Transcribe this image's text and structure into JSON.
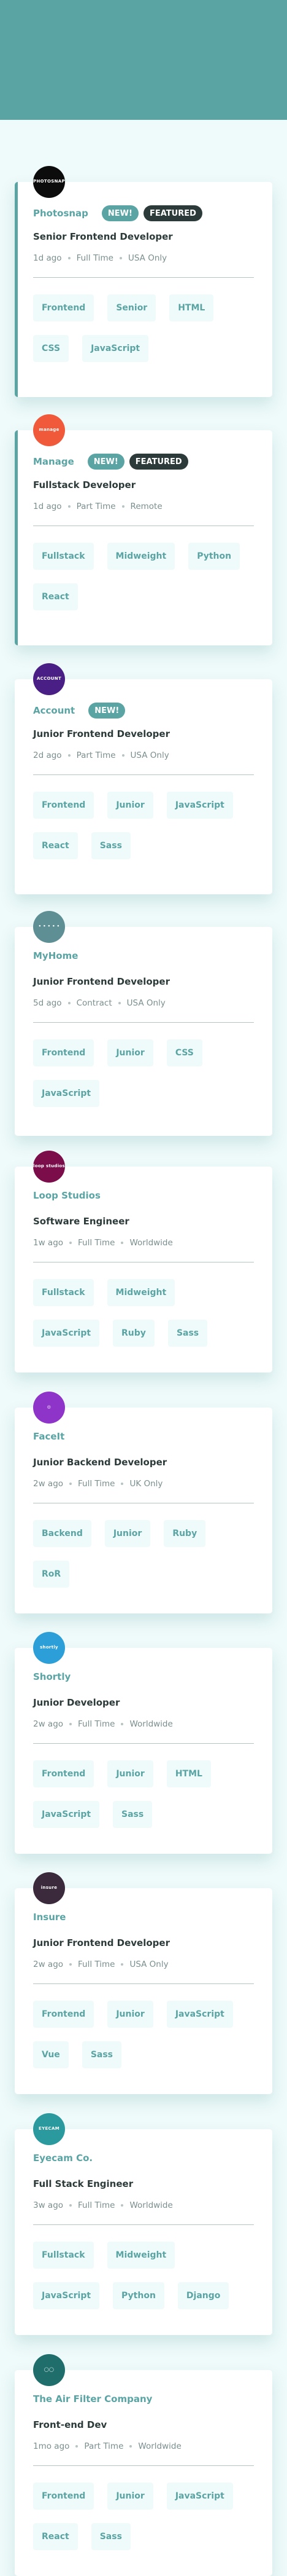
{
  "jobs": [
    {
      "company": "Photosnap",
      "logo_text": "PHOTOSNAP",
      "logo_color": "#0c0c0c",
      "new_label": "NEW!",
      "featured_label": "FEATURED",
      "position": "Senior Frontend Developer",
      "posted": "1d ago",
      "contract": "Full Time",
      "location": "USA Only",
      "tags": [
        "Frontend",
        "Senior",
        "HTML",
        "CSS",
        "JavaScript"
      ]
    },
    {
      "company": "Manage",
      "logo_text": "manage",
      "logo_color": "#f05a3a",
      "new_label": "NEW!",
      "featured_label": "FEATURED",
      "position": "Fullstack Developer",
      "posted": "1d ago",
      "contract": "Part Time",
      "location": "Remote",
      "tags": [
        "Fullstack",
        "Midweight",
        "Python",
        "React"
      ]
    },
    {
      "company": "Account",
      "logo_text": "ACCOUNT",
      "logo_color": "#4a1f85",
      "new_label": "NEW!",
      "position": "Junior Frontend Developer",
      "posted": "2d ago",
      "contract": "Part Time",
      "location": "USA Only",
      "tags": [
        "Frontend",
        "Junior",
        "JavaScript",
        "React",
        "Sass"
      ]
    },
    {
      "company": "MyHome",
      "logo_text": "• • • • •",
      "logo_color": "#5e8f94",
      "position": "Junior Frontend Developer",
      "posted": "5d ago",
      "contract": "Contract",
      "location": "USA Only",
      "tags": [
        "Frontend",
        "Junior",
        "CSS",
        "JavaScript"
      ]
    },
    {
      "company": "Loop Studios",
      "logo_text": "loop studios",
      "logo_color": "#7a0d4a",
      "position": "Software Engineer",
      "posted": "1w ago",
      "contract": "Full Time",
      "location": "Worldwide",
      "tags": [
        "Fullstack",
        "Midweight",
        "JavaScript",
        "Ruby",
        "Sass"
      ]
    },
    {
      "company": "FaceIt",
      "logo_text": "◎",
      "logo_color": "#8f34c9",
      "position": "Junior Backend Developer",
      "posted": "2w ago",
      "contract": "Full Time",
      "location": "UK Only",
      "tags": [
        "Backend",
        "Junior",
        "Ruby",
        "RoR"
      ]
    },
    {
      "company": "Shortly",
      "logo_text": "shortly",
      "logo_color": "#2c9fd8",
      "position": "Junior Developer",
      "posted": "2w ago",
      "contract": "Full Time",
      "location": "Worldwide",
      "tags": [
        "Frontend",
        "Junior",
        "HTML",
        "JavaScript",
        "Sass"
      ]
    },
    {
      "company": "Insure",
      "logo_text": "insure",
      "logo_color": "#3b2a3b",
      "position": "Junior Frontend Developer",
      "posted": "2w ago",
      "contract": "Full Time",
      "location": "USA Only",
      "tags": [
        "Frontend",
        "Junior",
        "JavaScript",
        "Vue",
        "Sass"
      ]
    },
    {
      "company": "Eyecam Co.",
      "logo_text": "EYECAM",
      "logo_color": "#2a9a9e",
      "position": "Full Stack Engineer",
      "posted": "3w ago",
      "contract": "Full Time",
      "location": "Worldwide",
      "tags": [
        "Fullstack",
        "Midweight",
        "JavaScript",
        "Python",
        "Django"
      ]
    },
    {
      "company": "The Air Filter Company",
      "logo_text": "◯◯",
      "logo_color": "#1f6e6c",
      "position": "Front-end Dev",
      "posted": "1mo ago",
      "contract": "Part Time",
      "location": "Worldwide",
      "tags": [
        "Frontend",
        "Junior",
        "JavaScript",
        "React",
        "Sass"
      ]
    }
  ]
}
